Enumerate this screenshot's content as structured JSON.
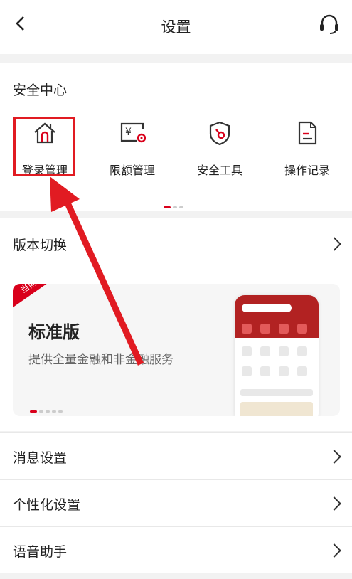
{
  "header": {
    "title": "设置"
  },
  "security": {
    "title": "安全中心",
    "tools": [
      {
        "label": "登录管理",
        "icon": "home-icon"
      },
      {
        "label": "限额管理",
        "icon": "limit-card-icon"
      },
      {
        "label": "安全工具",
        "icon": "shield-icon"
      },
      {
        "label": "操作记录",
        "icon": "document-icon"
      }
    ]
  },
  "version": {
    "title": "版本切换",
    "badge": "当前版本",
    "name": "标准版",
    "desc": "提供全量金融和非金融服务"
  },
  "settings": [
    {
      "label": "消息设置"
    },
    {
      "label": "个性化设置"
    },
    {
      "label": "语音助手"
    }
  ],
  "colors": {
    "accent": "#d9001b",
    "highlight": "#e11b22"
  }
}
